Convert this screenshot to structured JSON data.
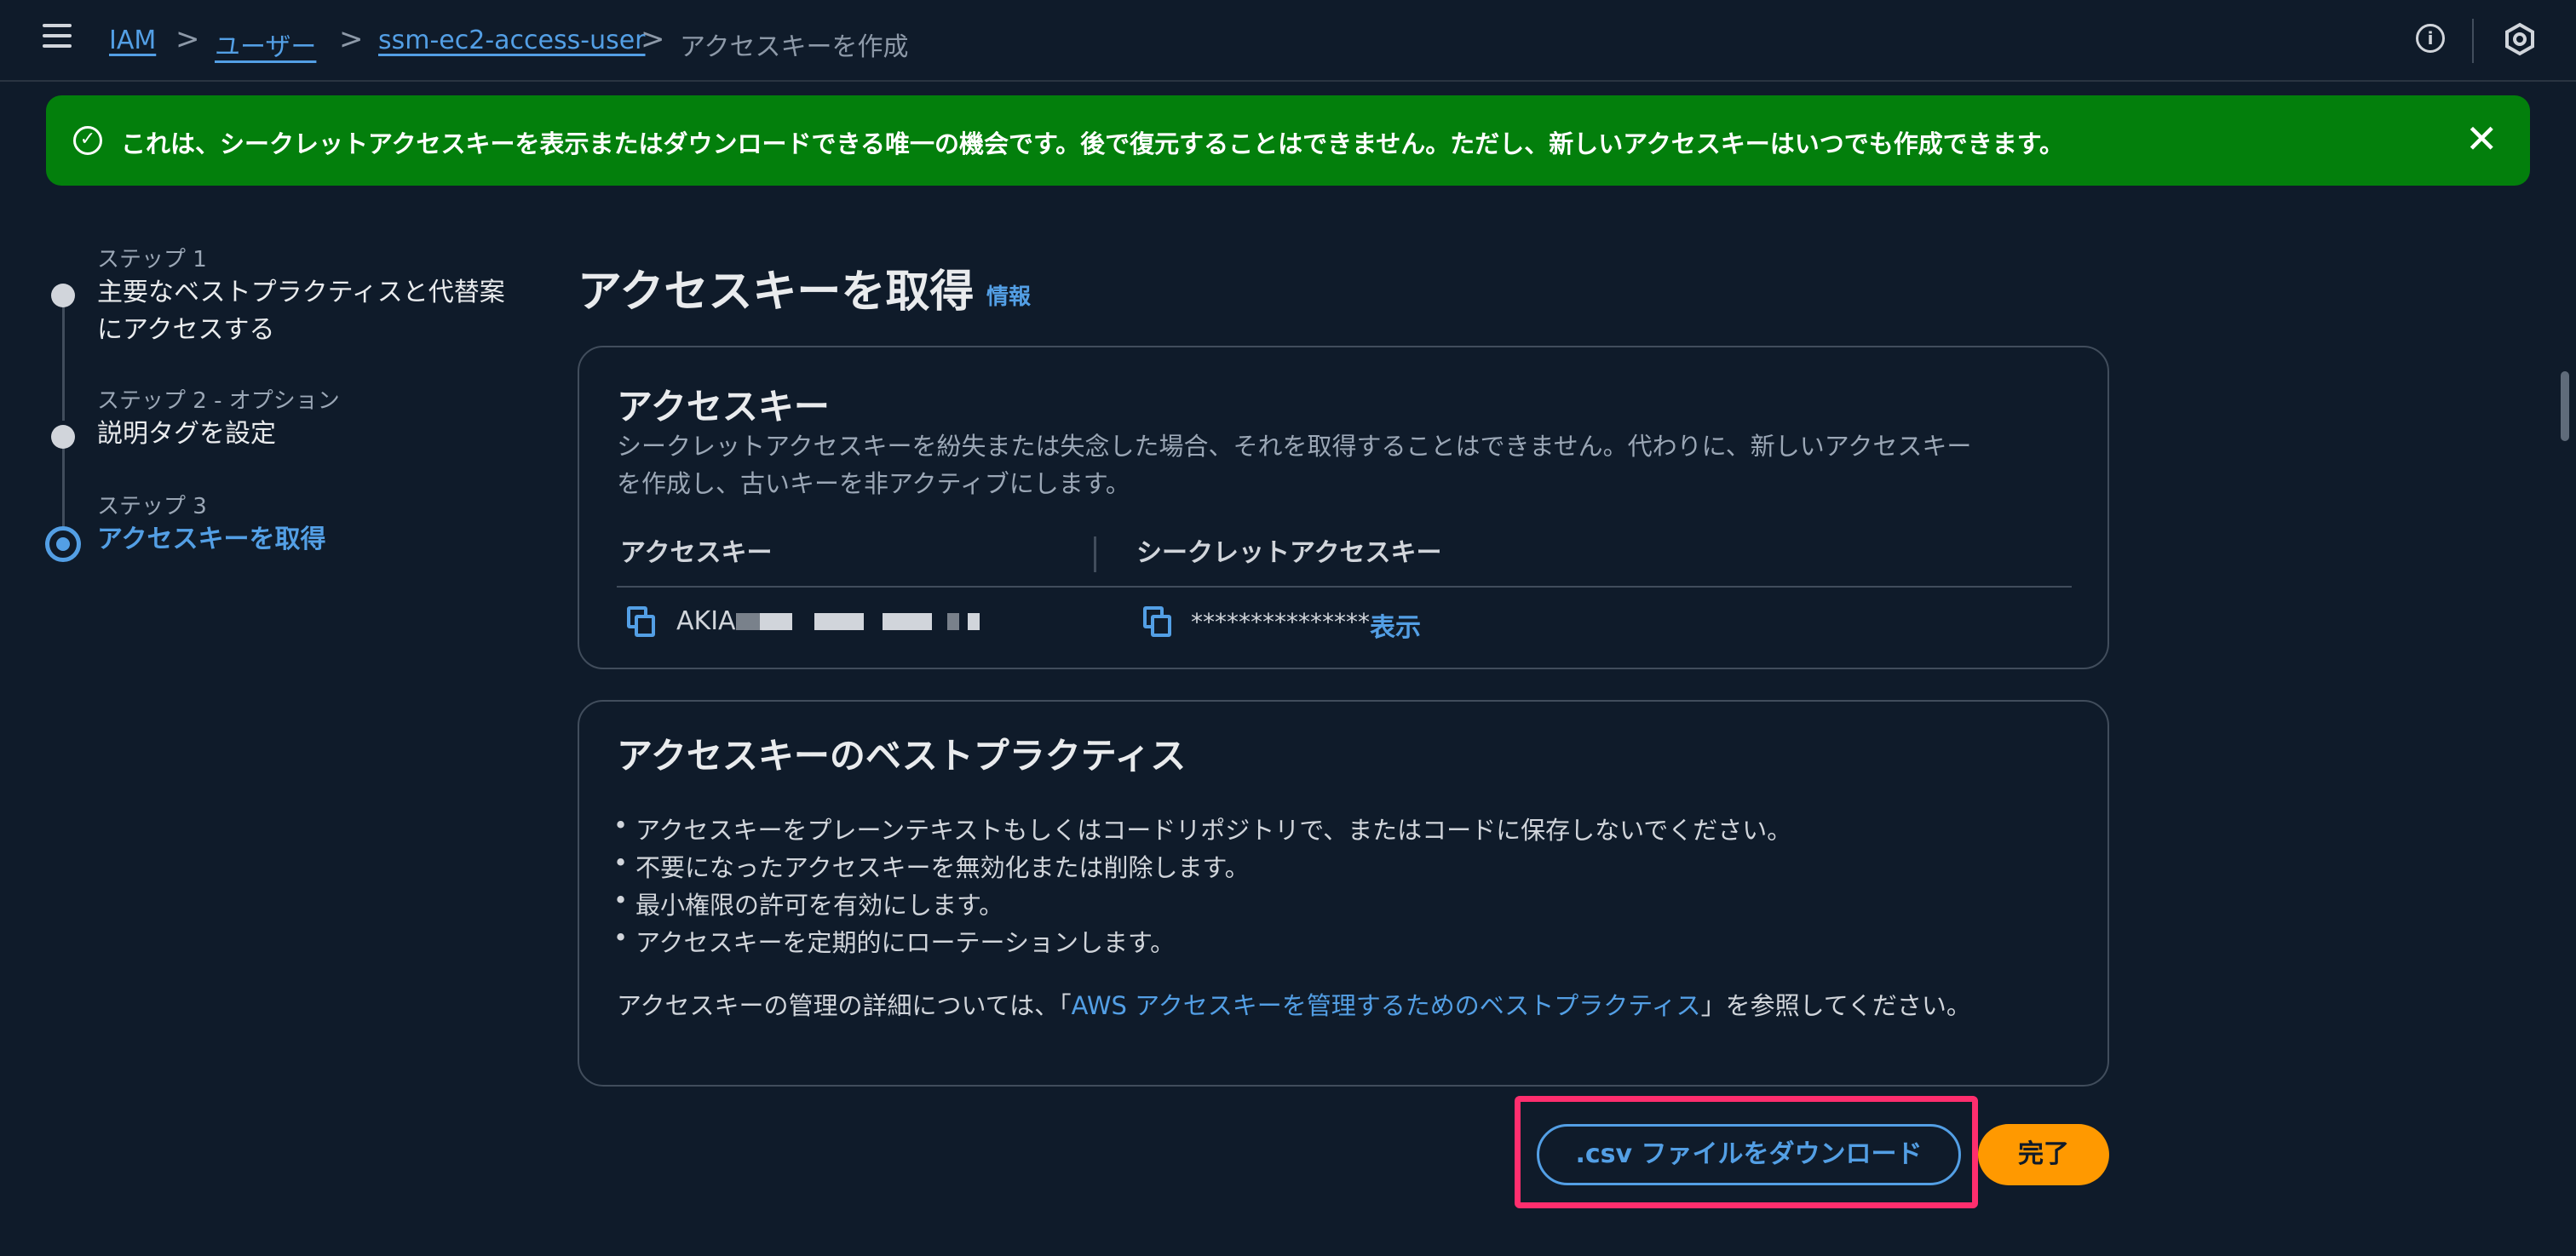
{
  "breadcrumb": {
    "items": [
      "IAM",
      "ユーザー",
      "ssm-ec2-access-user"
    ],
    "current": "アクセスキーを作成",
    "separator": ">"
  },
  "topbar": {
    "info_icon": "info-icon",
    "settings_icon": "settings-icon"
  },
  "banner": {
    "text": "これは、シークレットアクセスキーを表示またはダウンロードできる唯一の機会です。後で復元することはできません。ただし、新しいアクセスキーはいつでも作成できます。",
    "close": "✕",
    "check": "✓",
    "color": "#037f0c"
  },
  "steps": [
    {
      "label": "ステップ 1",
      "title_line1": "主要なベストプラクティスと代替案",
      "title_line2": "にアクセスする"
    },
    {
      "label": "ステップ 2 - オプション",
      "title_line1": "説明タグを設定"
    },
    {
      "label": "ステップ 3",
      "title_line1": "アクセスキーを取得"
    }
  ],
  "page": {
    "title": "アクセスキーを取得",
    "info": "情報"
  },
  "access_key_card": {
    "title": "アクセスキー",
    "desc_line1": "シークレットアクセスキーを紛失または失念した場合、それを取得することはできません。代わりに、新しいアクセスキー",
    "desc_line2": "を作成し、古いキーを非アクティブにします。",
    "col_access_key": "アクセスキー",
    "col_secret_key": "シークレットアクセスキー",
    "access_key_value": "AKIA",
    "secret_key_value": "***************",
    "show": "表示"
  },
  "best_practices_card": {
    "title": "アクセスキーのベストプラクティス",
    "bullets": [
      "アクセスキーをプレーンテキストもしくはコードリポジトリで、またはコードに保存しないでください。",
      "不要になったアクセスキーを無効化または削除します。",
      "最小権限の許可を有効にします。",
      "アクセスキーを定期的にローテーションします。"
    ],
    "ref_prefix": "アクセスキーの管理の詳細については、「",
    "ref_link": "AWS アクセスキーを管理するためのベストプラクティス",
    "ref_suffix": "」を参照してください。"
  },
  "actions": {
    "download_csv": ".csv ファイルをダウンロード",
    "done": "完了",
    "accent": "#ff9900",
    "link_color": "#539fe5",
    "highlight_color": "#ff2e6e"
  }
}
